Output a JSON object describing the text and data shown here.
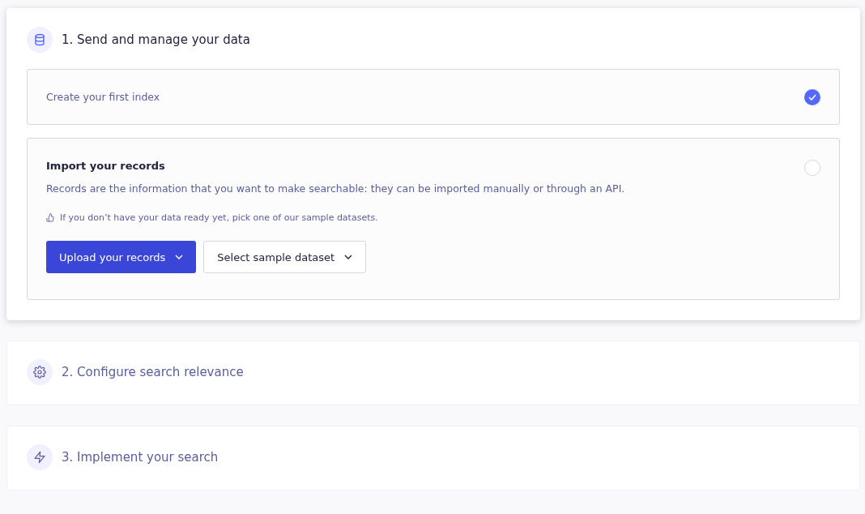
{
  "sections": [
    {
      "kind": "database",
      "title": "1. Send and manage your data",
      "expanded": true,
      "steps": [
        {
          "kind": "simple",
          "title": "Create your first index",
          "checked": true
        },
        {
          "kind": "detailed",
          "title": "Import your records",
          "checked": false,
          "description": "Records are the information that you want to make searchable: they can be imported manually or through an API.",
          "hint": "If you don’t have your data ready yet, pick one of our sample datasets.",
          "buttons": [
            {
              "label": "Upload your records",
              "primary": true
            },
            {
              "label": "Select sample dataset",
              "primary": false
            }
          ]
        }
      ]
    },
    {
      "kind": "gear",
      "title": "2. Configure search relevance",
      "expanded": false
    },
    {
      "kind": "bolt",
      "title": "3. Implement your search",
      "expanded": false
    }
  ]
}
